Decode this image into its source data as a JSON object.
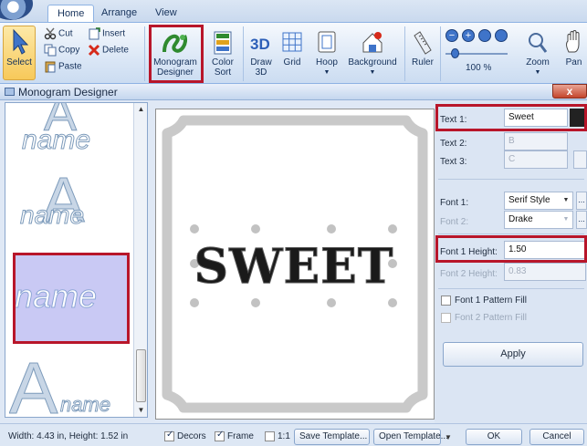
{
  "ribbon": {
    "tabs": [
      "Home",
      "Arrange",
      "View"
    ],
    "select_label": "Select",
    "cut_label": "Cut",
    "copy_label": "Copy",
    "paste_label": "Paste",
    "insert_label": "Insert",
    "delete_label": "Delete",
    "monogram_designer_label": [
      "Monogram",
      "Designer"
    ],
    "color_sort_label": [
      "Color",
      "Sort"
    ],
    "draw_3d_label": [
      "Draw",
      "3D"
    ],
    "grid_label": "Grid",
    "hoop_label": "Hoop",
    "background_label": "Background",
    "ruler_label": "Ruler",
    "zoom_value": "100 %",
    "zoom_label": "Zoom",
    "pan_label": "Pan"
  },
  "designer": {
    "title": "Monogram Designer",
    "close_label": "x"
  },
  "templates": {
    "sample_letter": "A",
    "sample_word": "name",
    "selected_index": 2
  },
  "preview": {
    "text": "SWEET"
  },
  "form": {
    "text1_label": "Text 1:",
    "text1_value": "Sweet",
    "text2_label": "Text 2:",
    "text2_value": "B",
    "text3_label": "Text 3:",
    "text3_value": "C",
    "font1_label": "Font 1:",
    "font1_value": "Serif Style",
    "font2_label": "Font 2:",
    "font2_value": "Drake",
    "font1_height_label": "Font 1 Height:",
    "font1_height_value": "1.50",
    "font2_height_label": "Font 2 Height:",
    "font2_height_value": "0.83",
    "font1_pattern_label": "Font 1 Pattern Fill",
    "font2_pattern_label": "Font 2 Pattern Fill",
    "ellipsis_label": "...",
    "apply_label": "Apply"
  },
  "status": {
    "dimensions": "Width: 4.43 in, Height: 1.52 in",
    "decors_label": "Decors",
    "decors_checked": true,
    "frame_label": "Frame",
    "frame_checked": true,
    "ratio_label": "1:1",
    "ratio_checked": false,
    "save_template_label": "Save Template...",
    "open_template_label": "Open Template...",
    "ok_label": "OK",
    "cancel_label": "Cancel"
  },
  "colors": {
    "highlight": "#b8162a",
    "ribbon_bg": "#dbe7f6",
    "selected_template_bg": "#c9c9f4"
  }
}
